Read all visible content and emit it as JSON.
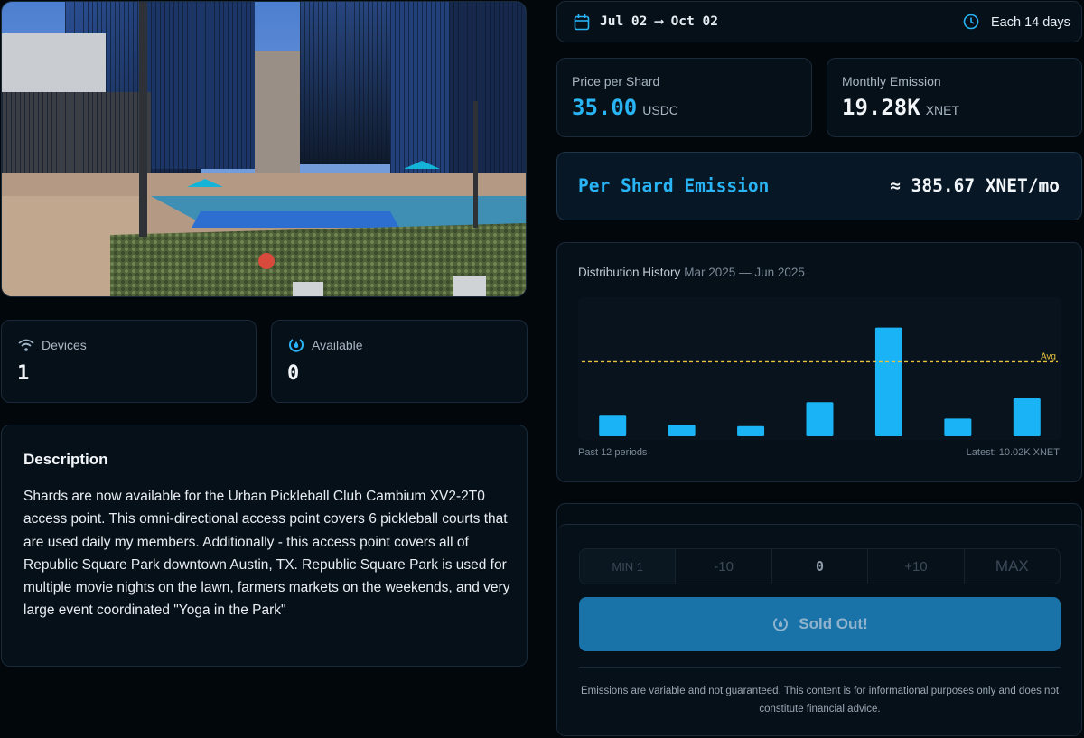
{
  "photo": {
    "alt": "Urban Pickleball Club rooftop courts"
  },
  "stats": {
    "devices": {
      "label": "Devices",
      "value": "1",
      "icon": "wifi-icon"
    },
    "available": {
      "label": "Available",
      "value": "0",
      "icon": "droplet-icon"
    }
  },
  "description": {
    "title": "Description",
    "text": "Shards are now available for the Urban Pickleball Club Cambium XV2-2T0 access point. This omni-directional access point covers 6 pickleball courts that are used daily my members. Additionally - this access point covers all of Republic Square Park downtown Austin, TX. Republic Square Park is used for multiple movie nights on the lawn, farmers markets on the weekends, and very large event coordinated \"Yoga in the Park\""
  },
  "period": {
    "range": "Jul 02 ⟶ Oct 02",
    "frequency": "Each 14 days"
  },
  "price": {
    "label": "Price per Shard",
    "value": "35.00",
    "unit": "USDC"
  },
  "monthly": {
    "label": "Monthly Emission",
    "value": "19.28K",
    "unit": "XNET"
  },
  "per_shard": {
    "label": "Per Shard Emission",
    "value": "≈ 385.67 XNET/mo"
  },
  "history": {
    "title": "Distribution History",
    "range": "Mar 2025 — Jun 2025",
    "footer_left": "Past 12 periods",
    "footer_right": "Latest: 10.02K XNET"
  },
  "chart_data": {
    "type": "bar",
    "values": [
      1.7,
      0.9,
      0.8,
      2.7,
      8.6,
      1.4,
      3.0
    ],
    "avg": 5.9,
    "avg_label": "Avg",
    "ylim": [
      0,
      11
    ],
    "bar_color": "#1ab3f5",
    "avg_color": "#e8c23a"
  },
  "purchase": {
    "min_label": "MIN 1",
    "minus_label": "-10",
    "quantity": "0",
    "plus_label": "+10",
    "max_label": "MAX",
    "button_label": "Sold Out!",
    "disclaimer": "Emissions are variable and not guaranteed. This content is for informational purposes only and does not constitute financial advice."
  },
  "colors": {
    "accent": "#28b4f5",
    "background": "#02070c",
    "card": "#061019"
  }
}
